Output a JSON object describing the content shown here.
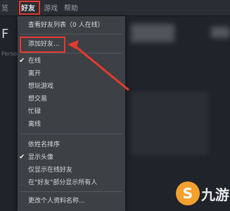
{
  "menubar": {
    "items": [
      "览",
      "好友",
      "游戏",
      "帮助"
    ]
  },
  "background": {
    "letter": "F",
    "small_text": "Persona"
  },
  "dropdown": {
    "items": [
      {
        "label": "查看好友列表（0 人在线）",
        "checked": false
      },
      {
        "label": "添加好友...",
        "checked": false,
        "highlighted": true
      },
      {
        "label": "在线",
        "checked": true
      },
      {
        "label": "离开",
        "checked": false
      },
      {
        "label": "想玩游戏",
        "checked": false
      },
      {
        "label": "想交易",
        "checked": false
      },
      {
        "label": "忙碌",
        "checked": false
      },
      {
        "label": "离线",
        "checked": false
      },
      {
        "label": "依姓名排序",
        "checked": false
      },
      {
        "label": "显示头像",
        "checked": true
      },
      {
        "label": "仅显示在线好友",
        "checked": false
      },
      {
        "label": "在\"好友\"部分显示所有人",
        "checked": false
      },
      {
        "label": "更改个人资料名称...",
        "checked": false
      }
    ]
  },
  "watermark": {
    "icon_glyph": "S",
    "text": "九游"
  },
  "colors": {
    "highlight_red": "#e53a2e",
    "menu_bg": "#3d4045",
    "logo_orange": "#f2a12f"
  }
}
